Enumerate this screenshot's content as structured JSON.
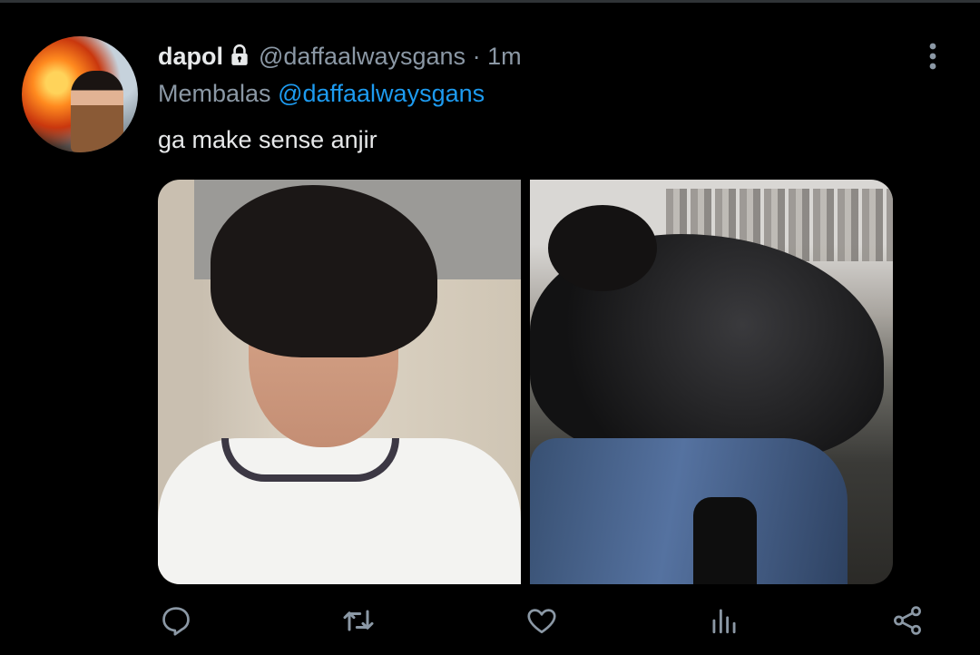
{
  "tweet": {
    "display_name": "dapol",
    "protected_icon": "lock-icon",
    "handle": "@daffaalwaysgans",
    "separator": "·",
    "time": "1m",
    "reply_prefix": "Membalas",
    "reply_to": "@daffaalwaysgans",
    "text": "ga make sense anjir",
    "more_icon": "more-vertical-icon"
  },
  "actions": [
    {
      "name": "reply",
      "icon": "reply-icon"
    },
    {
      "name": "retweet",
      "icon": "retweet-icon"
    },
    {
      "name": "like",
      "icon": "heart-icon"
    },
    {
      "name": "analytics",
      "icon": "analytics-icon"
    },
    {
      "name": "share",
      "icon": "share-icon"
    }
  ],
  "colors": {
    "background": "#000000",
    "text": "#e7e9ea",
    "secondary": "#8b98a5",
    "link": "#1d9bf0"
  }
}
